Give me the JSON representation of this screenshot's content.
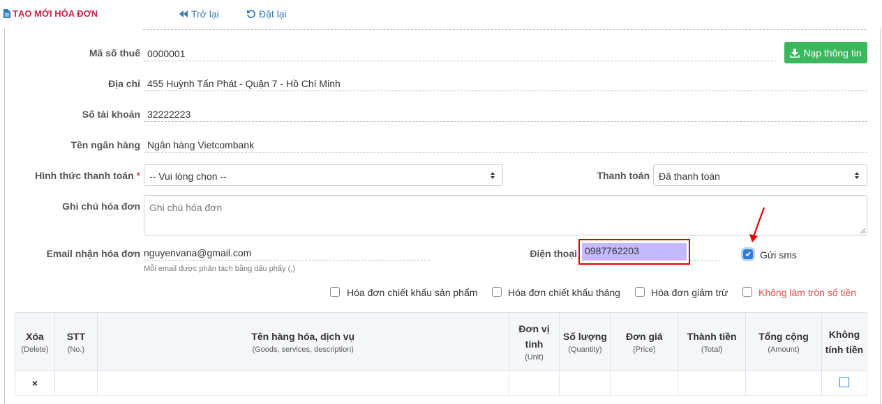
{
  "header": {
    "title": "TẠO MỚI HÓA ĐƠN",
    "back_label": "Trở lại",
    "reset_label": "Đặt lại"
  },
  "form": {
    "tax_code": {
      "label": "Mã số thuế",
      "value": "0000001"
    },
    "load_info_label": "Nạp thông tin",
    "address": {
      "label": "Địa chỉ",
      "value": "455 Huỳnh Tấn Phát - Quận 7 - Hồ Chí Minh"
    },
    "account_number": {
      "label": "Số tài khoản",
      "value": "32222223"
    },
    "bank_name": {
      "label": "Tên ngân hàng",
      "value": "Ngân hàng Vietcombank"
    },
    "payment_method": {
      "label": "Hình thức thanh toán",
      "required_mark": "*",
      "selected": "-- Vui lòng chon --"
    },
    "payment_status": {
      "label": "Thanh toán",
      "selected": "Đã thanh toán"
    },
    "note": {
      "label": "Ghi chú hóa đơn",
      "placeholder": "Ghi chú hóa đơn"
    },
    "email": {
      "label": "Email nhận hóa đơn",
      "value": "nguyenvana@gmail.com",
      "hint": "Mỗi email được phân tách bằng dấu phẩy (,)"
    },
    "phone": {
      "label": "Điện thoại",
      "value": "0987762203"
    },
    "send_sms": {
      "label": "Gửi sms",
      "checked": true
    }
  },
  "options": [
    {
      "label": "Hóa đơn chiết khấu sản phẩm",
      "checked": false
    },
    {
      "label": "Hóa đơn chiết khấu tháng",
      "checked": false
    },
    {
      "label": "Hóa đơn giảm trừ",
      "checked": false
    },
    {
      "label": "Không làm tròn số tiền",
      "checked": false
    }
  ],
  "table": {
    "columns": [
      {
        "title": "Xóa",
        "sub": "(Delete)"
      },
      {
        "title": "STT",
        "sub": "(No.)"
      },
      {
        "title": "Tên hàng hóa, dịch vụ",
        "sub": "(Goods, services, description)"
      },
      {
        "title": "Đơn vị tính",
        "sub": "(Unit)"
      },
      {
        "title": "Số lượng",
        "sub": "(Quantity)"
      },
      {
        "title": "Đơn giá",
        "sub": "(Price)"
      },
      {
        "title": "Thành tiền",
        "sub": "(Total)"
      },
      {
        "title": "Tổng cộng",
        "sub": "(Amount)"
      },
      {
        "title": "Không tính tiền",
        "sub": ""
      }
    ],
    "row_delete_icon": "×"
  },
  "colors": {
    "accent_red": "#c7254e",
    "link_blue": "#337ab7",
    "green": "#3bb75e",
    "highlight": "#c4b8ff"
  }
}
